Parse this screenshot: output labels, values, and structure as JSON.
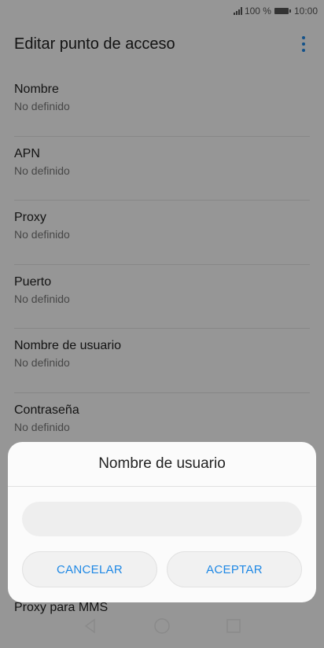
{
  "status": {
    "signal_icon": "signal-icon",
    "battery": "100 %",
    "battery_icon": "battery-icon",
    "time": "10:00"
  },
  "header": {
    "title": "Editar punto de acceso",
    "menu_icon": "overflow-menu-icon"
  },
  "list": {
    "items": [
      {
        "label": "Nombre",
        "value": "No definido"
      },
      {
        "label": "APN",
        "value": "No definido"
      },
      {
        "label": "Proxy",
        "value": "No definido"
      },
      {
        "label": "Puerto",
        "value": "No definido"
      },
      {
        "label": "Nombre de usuario",
        "value": "No definido"
      },
      {
        "label": "Contraseña",
        "value": "No definido"
      },
      {
        "label": "Proxy para MMS",
        "value": ""
      }
    ]
  },
  "dialog": {
    "title": "Nombre de usuario",
    "input_value": "",
    "cancel_label": "CANCELAR",
    "accept_label": "ACEPTAR",
    "accent_color": "#1e88e5"
  },
  "navbar": {
    "back_icon": "back-icon",
    "home_icon": "home-icon",
    "recents_icon": "recents-icon"
  }
}
